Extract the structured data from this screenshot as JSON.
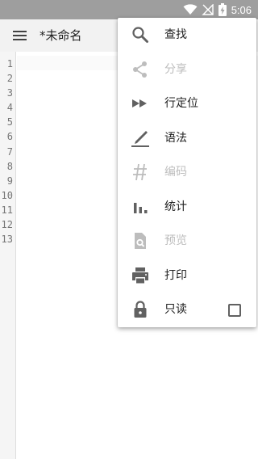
{
  "status_bar": {
    "time": "5:06"
  },
  "toolbar": {
    "title": "*未命名"
  },
  "editor": {
    "line_numbers": [
      "1",
      "2",
      "3",
      "4",
      "5",
      "6",
      "7",
      "8",
      "9",
      "10",
      "11",
      "12",
      "13"
    ]
  },
  "menu": {
    "items": [
      {
        "label": "查找",
        "icon": "search-icon",
        "enabled": true
      },
      {
        "label": "分享",
        "icon": "share-icon",
        "enabled": false
      },
      {
        "label": "行定位",
        "icon": "fast-forward-icon",
        "enabled": true
      },
      {
        "label": "语法",
        "icon": "pen-icon",
        "enabled": true
      },
      {
        "label": "编码",
        "icon": "hash-icon",
        "enabled": false
      },
      {
        "label": "统计",
        "icon": "bar-chart-icon",
        "enabled": true
      },
      {
        "label": "预览",
        "icon": "file-search-icon",
        "enabled": false
      },
      {
        "label": "打印",
        "icon": "printer-icon",
        "enabled": true
      },
      {
        "label": "只读",
        "icon": "lock-icon",
        "enabled": true,
        "checked": false
      }
    ]
  },
  "colors": {
    "icon_enabled": "#616161",
    "icon_disabled": "#bdbdbd",
    "status_bar": "#9e9e9e",
    "toolbar": "#f2f2f2"
  }
}
